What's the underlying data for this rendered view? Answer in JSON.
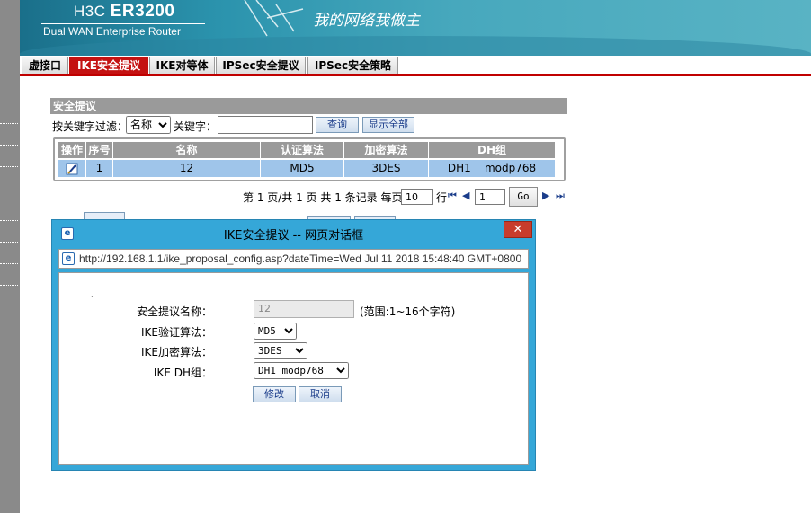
{
  "header": {
    "brand": "H3C",
    "model": "ER3200",
    "subtitle": "Dual WAN Enterprise Router",
    "slogan": "我的网络我做主"
  },
  "tabs": [
    {
      "label": "虚接口",
      "active": false
    },
    {
      "label": "IKE安全提议",
      "active": true
    },
    {
      "label": "IKE对等体",
      "active": false
    },
    {
      "label": "IPSec安全提议",
      "active": false
    },
    {
      "label": "IPSec安全策略",
      "active": false
    }
  ],
  "section_title": "安全提议",
  "filter": {
    "filter_label": "按关键字过滤：",
    "field_selected": "名称",
    "field_options": [
      "名称"
    ],
    "keyword_label": "关键字：",
    "keyword_value": "",
    "query_button": "查询",
    "show_all_button": "显示全部"
  },
  "table": {
    "headers": [
      "操作",
      "序号",
      "名称",
      "认证算法",
      "加密算法",
      "DH组"
    ],
    "rows": [
      {
        "index": "1",
        "name": "12",
        "auth": "MD5",
        "enc": "3DES",
        "dh": "DH1    modp768"
      }
    ]
  },
  "pager": {
    "text_page": "第 1 页/共 1 页 共 1 条记录 每页",
    "per_page": "10",
    "rows_unit": "行",
    "current_page": "1",
    "go_button": "Go"
  },
  "dialog": {
    "title": "IKE安全提议 -- 网页对话框",
    "close_glyph": "✕",
    "url": "http://192.168.1.1/ike_proposal_config.asp?dateTime=Wed Jul 11 2018 15:48:40 GMT+0800",
    "form": {
      "name_label": "安全提议名称：",
      "name_value": "12",
      "name_hint": "(范围:1~16个字符)",
      "auth_label": "IKE验证算法：",
      "auth_value": "MD5",
      "enc_label": "IKE加密算法：",
      "enc_value": "3DES",
      "dh_label": "IKE DH组：",
      "dh_value": "DH1 modp768",
      "modify_button": "修改",
      "cancel_button": "取消"
    }
  },
  "colors": {
    "header_bg": "#2b93ad",
    "active_tab": "#c41212",
    "tab_rule": "#c00000",
    "section_bg": "#9a9a9a",
    "row_selected": "#9fc5ea",
    "dialog_frame": "#35a7d8",
    "close_button": "#c83c2c"
  },
  "icons": {
    "edit": "edit-icon",
    "first": "first-page-icon",
    "prev": "prev-page-icon",
    "next": "next-page-icon",
    "last": "last-page-icon",
    "ie": "ie-page-icon"
  }
}
